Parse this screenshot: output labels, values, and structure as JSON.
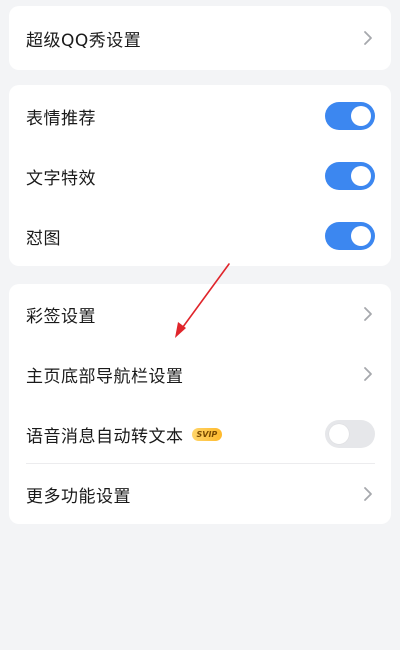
{
  "sections": {
    "top": {
      "item_label": "超级QQ秀设置"
    },
    "toggles": {
      "items": [
        {
          "label": "表情推荐",
          "state": "on"
        },
        {
          "label": "文字特效",
          "state": "on"
        },
        {
          "label": "怼图",
          "state": "on"
        }
      ]
    },
    "more": {
      "items": [
        {
          "label": "彩签设置",
          "control": "chevron"
        },
        {
          "label": "主页底部导航栏设置",
          "control": "chevron"
        },
        {
          "label": "语音消息自动转文本",
          "badge": "SVIP",
          "control": "toggle",
          "state": "off"
        },
        {
          "label": "更多功能设置",
          "control": "chevron"
        }
      ]
    }
  },
  "colors": {
    "toggle_on": "#3c87f0",
    "toggle_off": "#e6e7ea",
    "annotation_arrow": "#e0252b",
    "svip_badge": "#ffc43d"
  },
  "icons": {
    "chevron": "chevron-right-icon",
    "arrow": "red-annotation-arrow"
  }
}
